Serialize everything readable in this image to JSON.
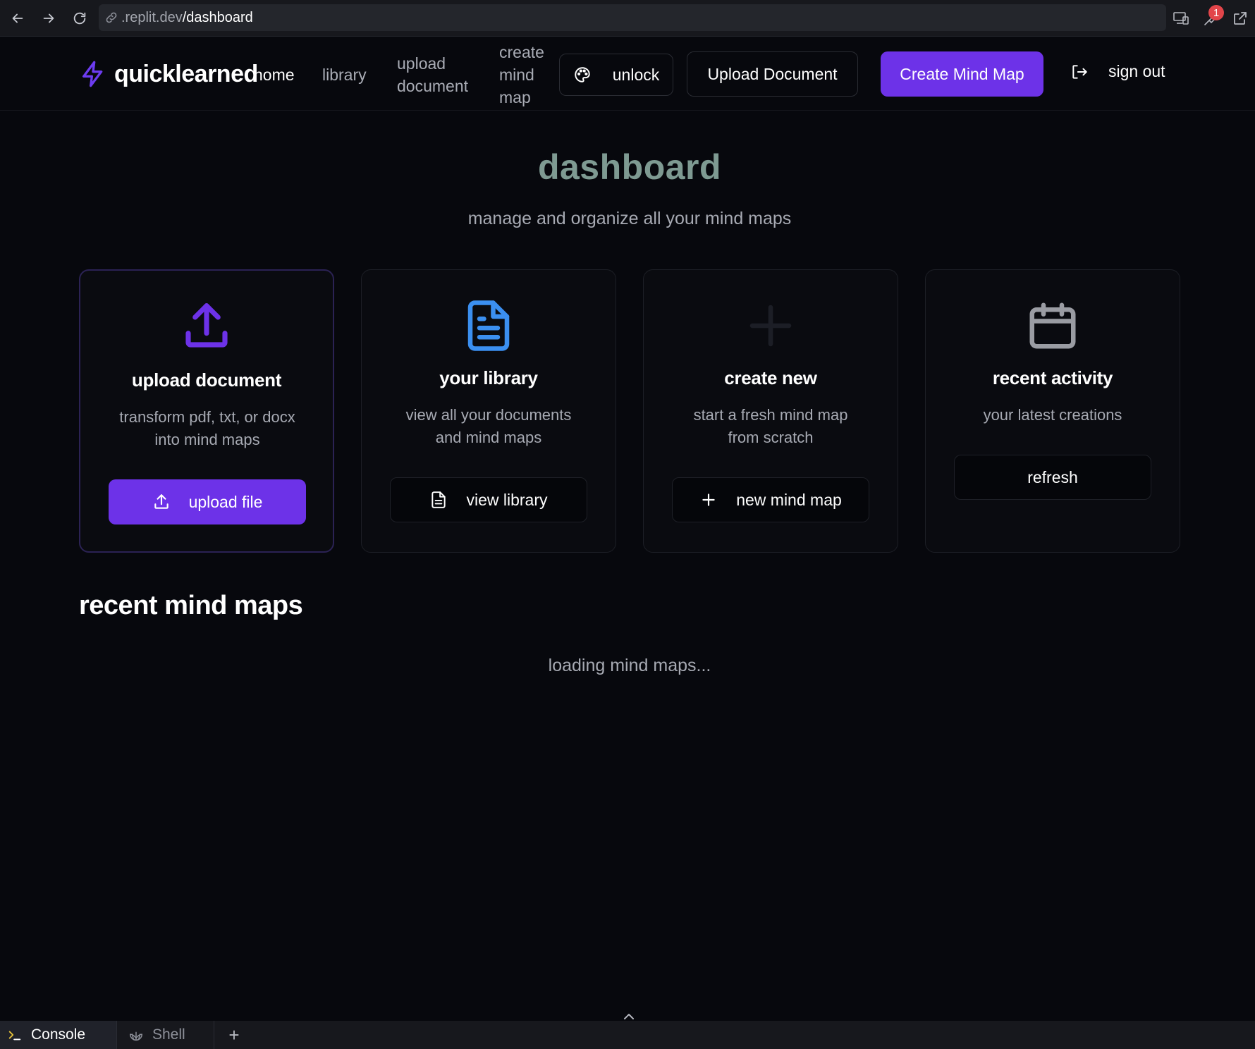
{
  "browser": {
    "url_host": ".replit.dev",
    "url_path": "/dashboard",
    "notification_count": "1"
  },
  "header": {
    "logo_text": "quicklearned",
    "nav": {
      "home": "home",
      "library": "library",
      "upload_line1": "upload",
      "upload_line2": "document",
      "create_line1": "create",
      "create_line2": "mind",
      "create_line3": "map"
    },
    "unlock_label": "unlock",
    "upload_document_label": "Upload Document",
    "create_mind_map_label": "Create Mind Map",
    "sign_out_label": "sign out"
  },
  "hero": {
    "title": "dashboard",
    "subtitle": "manage and organize all your mind maps"
  },
  "cards": [
    {
      "icon": "upload-icon",
      "title": "upload document",
      "desc_line1": "transform pdf, txt, or docx",
      "desc_line2": "into mind maps",
      "button_label": "upload file",
      "accent": "#6d32e8"
    },
    {
      "icon": "document-icon",
      "title": "your library",
      "desc_line1": "view all your documents",
      "desc_line2": "and mind maps",
      "button_label": "view library",
      "accent": "#3b8ff0"
    },
    {
      "icon": "plus-icon",
      "title": "create new",
      "desc_line1": "start a fresh mind map",
      "desc_line2": "from scratch",
      "button_label": "new mind map"
    },
    {
      "icon": "calendar-icon",
      "title": "recent activity",
      "desc_line1": "your latest creations",
      "button_label": "refresh"
    }
  ],
  "recent": {
    "title": "recent mind maps",
    "loading_text": "loading mind maps..."
  },
  "console": {
    "tabs": [
      "Console",
      "Shell"
    ],
    "add_label": "+"
  }
}
